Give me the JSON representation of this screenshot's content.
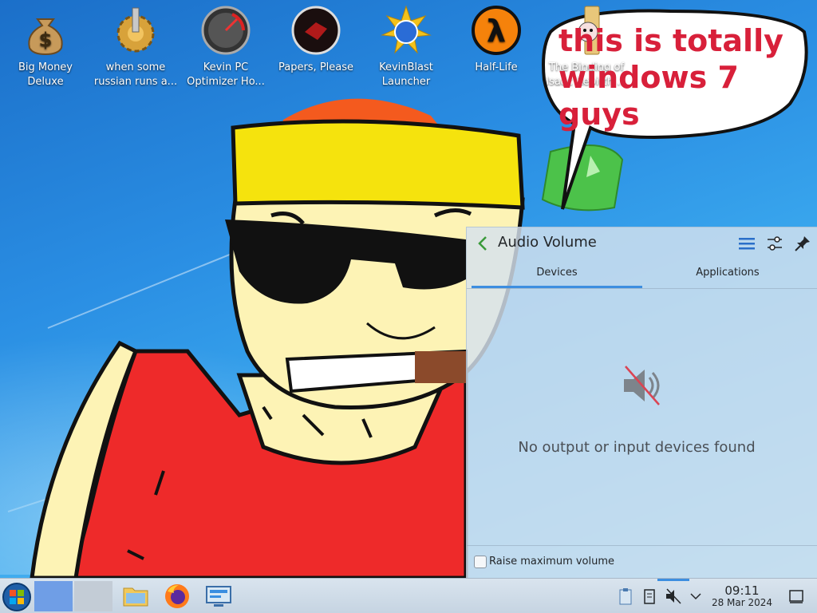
{
  "desktop": {
    "icons": [
      {
        "label_line1": "Big Money",
        "label_line2": "Deluxe",
        "icon": "money-bag-icon"
      },
      {
        "label_line1": "when some",
        "label_line2": "russian runs a...",
        "icon": "gear-icon"
      },
      {
        "label_line1": "Kevin PC",
        "label_line2": "Optimizer Ho...",
        "icon": "speedometer-icon"
      },
      {
        "label_line1": "Papers, Please",
        "label_line2": "",
        "icon": "papers-please-icon"
      },
      {
        "label_line1": "KevinBlast",
        "label_line2": "Launcher",
        "icon": "sun-globe-icon"
      },
      {
        "label_line1": "Half-Life",
        "label_line2": "",
        "icon": "lambda-icon"
      },
      {
        "label_line1": "The Binding of",
        "label_line2": "Isaac Rebirth ...",
        "icon": "folder-isaac-icon"
      }
    ]
  },
  "speech_bubble": {
    "line1": "this is totally",
    "line2": "windows 7 guys"
  },
  "audio_popup": {
    "title": "Audio Volume",
    "tabs": [
      {
        "label": "Devices",
        "active": true
      },
      {
        "label": "Applications",
        "active": false
      }
    ],
    "empty_message": "No output or input devices found",
    "raise_max_label": "Raise maximum volume",
    "raise_max_checked": false,
    "accent_color": "#3d8ee0"
  },
  "taskbar": {
    "clock_time": "09:11",
    "clock_date": "28 Mar 2024",
    "apps": [
      "file-manager-icon",
      "firefox-icon",
      "system-settings-icon"
    ],
    "tray": [
      "clipboard-icon",
      "notes-icon",
      "volume-muted-icon",
      "chevron-down-icon",
      "show-desktop-icon"
    ]
  }
}
